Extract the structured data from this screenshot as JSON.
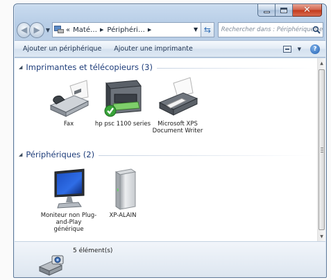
{
  "window": {
    "address": {
      "segments": [
        "Maté…",
        "Périphéri…"
      ],
      "prefix": "«"
    },
    "search": {
      "placeholder": "Rechercher dans : Périphériques et im…"
    },
    "close_glyph": "✕"
  },
  "commands": {
    "add_device": "Ajouter un périphérique",
    "add_printer": "Ajouter une imprimante",
    "help": "?"
  },
  "groups": [
    {
      "title": "Imprimantes et télécopieurs (3)",
      "items": [
        {
          "label": "Fax",
          "icon": "fax-icon"
        },
        {
          "label": "hp psc 1100 series",
          "icon": "multifunction-printer-icon",
          "default": true
        },
        {
          "label": "Microsoft XPS Document Writer",
          "icon": "printer-icon"
        }
      ]
    },
    {
      "title": "Périphériques (2)",
      "items": [
        {
          "label": "Moniteur non Plug-and-Play générique",
          "icon": "monitor-icon"
        },
        {
          "label": "XP-ALAIN",
          "icon": "computer-tower-icon"
        }
      ]
    }
  ],
  "status": {
    "count_text": "5 élément(s)"
  },
  "colors": {
    "accent": "#1e3d7a",
    "window_frame": "#bcd0e7",
    "close": "#c2391c"
  }
}
